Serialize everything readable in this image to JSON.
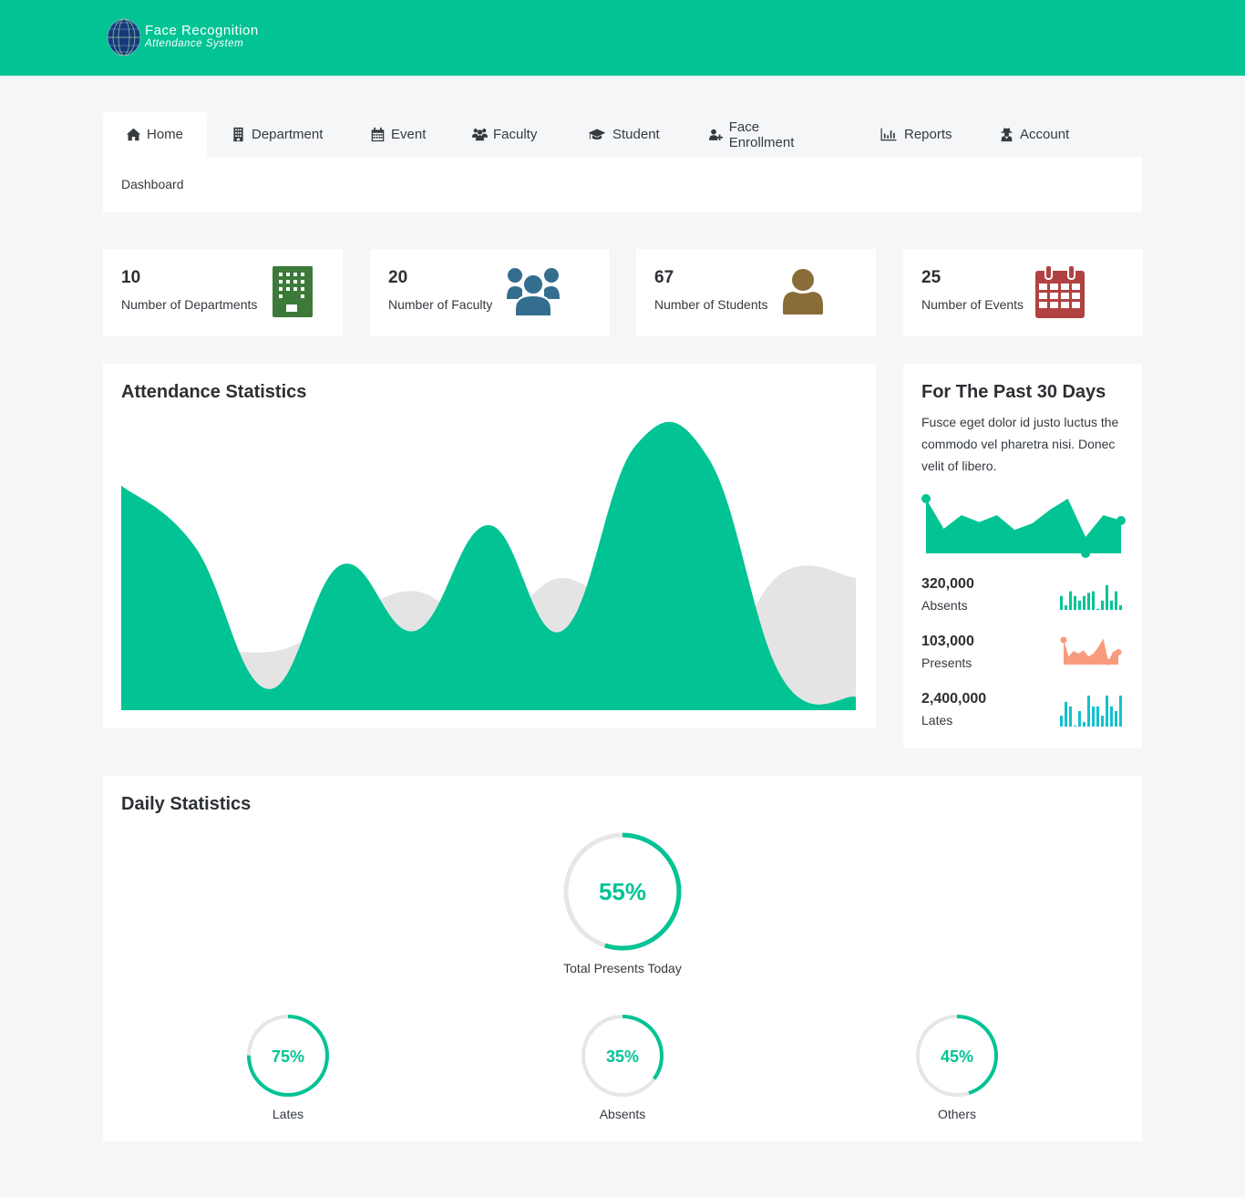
{
  "app": {
    "title_line1": "Face Recognition",
    "title_line2": "Attendance System",
    "brand_color": "#02c394"
  },
  "nav": {
    "tabs": [
      {
        "label": "Home",
        "icon": "home-icon",
        "active": true
      },
      {
        "label": "Department",
        "icon": "building-icon",
        "active": false
      },
      {
        "label": "Event",
        "icon": "calendar-icon",
        "active": false
      },
      {
        "label": "Faculty",
        "icon": "users-icon",
        "active": false
      },
      {
        "label": "Student",
        "icon": "graduation-cap-icon",
        "active": false
      },
      {
        "label": "Face Enrollment",
        "icon": "user-plus-icon",
        "active": false
      },
      {
        "label": "Reports",
        "icon": "bar-chart-icon",
        "active": false
      },
      {
        "label": "Account",
        "icon": "user-secret-icon",
        "active": false
      }
    ],
    "breadcrumb": "Dashboard"
  },
  "stats": [
    {
      "value": "10",
      "label": "Number of Departments",
      "icon": "building-icon",
      "color": "#3d7a3a"
    },
    {
      "value": "20",
      "label": "Number of Faculty",
      "icon": "users-icon",
      "color": "#336e8f"
    },
    {
      "value": "67",
      "label": "Number of Students",
      "icon": "user-icon",
      "color": "#8a6c38"
    },
    {
      "value": "25",
      "label": "Number of Events",
      "icon": "calendar-icon",
      "color": "#b04342"
    }
  ],
  "attendance": {
    "title": "Attendance Statistics"
  },
  "past30": {
    "title": "For The Past 30 Days",
    "description": "Fusce eget dolor id justo luctus the commodo vel pharetra nisi. Donec velit of libero.",
    "metrics": [
      {
        "value": "320,000",
        "label": "Absents",
        "color": "#02c394"
      },
      {
        "value": "103,000",
        "label": "Presents",
        "color": "#f89b7c"
      },
      {
        "value": "2,400,000",
        "label": "Lates",
        "color": "#12c1cc"
      }
    ]
  },
  "daily": {
    "title": "Daily Statistics",
    "main": {
      "percent": 55,
      "text": "55%",
      "label": "Total Presents Today"
    },
    "items": [
      {
        "percent": 75,
        "text": "75%",
        "label": "Lates"
      },
      {
        "percent": 35,
        "text": "35%",
        "label": "Absents"
      },
      {
        "percent": 45,
        "text": "45%",
        "label": "Others"
      }
    ]
  },
  "chart_data": [
    {
      "type": "area",
      "title": "Attendance Statistics",
      "xlabel": "",
      "ylabel": "",
      "grid": false,
      "legend": "none",
      "x": [
        0,
        1,
        2,
        3,
        4,
        5,
        6,
        7,
        8,
        9,
        10
      ],
      "ylim": [
        0,
        100
      ],
      "series": [
        {
          "name": "primary",
          "color": "#02c394",
          "values": [
            85,
            62,
            8,
            55,
            30,
            70,
            30,
            100,
            95,
            12,
            5
          ]
        },
        {
          "name": "secondary",
          "color": "#e4e4e4",
          "values": [
            60,
            30,
            22,
            34,
            45,
            30,
            50,
            30,
            15,
            52,
            50
          ]
        }
      ]
    },
    {
      "type": "area",
      "title": "Past 30 Days trend",
      "x": [
        0,
        1,
        2,
        3,
        4,
        5,
        6,
        7,
        8,
        9,
        10,
        11
      ],
      "ylim": [
        0,
        100
      ],
      "series": [
        {
          "name": "trend",
          "color": "#02c394",
          "values": [
            100,
            45,
            70,
            57,
            70,
            43,
            55,
            80,
            100,
            30,
            70,
            60
          ]
        }
      ]
    },
    {
      "type": "bar",
      "title": "Absents sparkline",
      "series": [
        {
          "name": "Absents",
          "color": "#02c394",
          "values": [
            45,
            15,
            60,
            45,
            30,
            45,
            55,
            60,
            3,
            30,
            80,
            30,
            60,
            15
          ]
        }
      ]
    },
    {
      "type": "area",
      "title": "Presents sparkline",
      "series": [
        {
          "name": "Presents",
          "color": "#f89b7c",
          "values": [
            90,
            30,
            50,
            40,
            52,
            30,
            40,
            65,
            95,
            10,
            50,
            45
          ]
        }
      ]
    },
    {
      "type": "bar",
      "title": "Lates sparkline",
      "series": [
        {
          "name": "Lates",
          "color": "#12c1cc",
          "values": [
            35,
            80,
            65,
            3,
            50,
            15,
            100,
            65,
            65,
            35,
            100,
            65,
            50,
            100
          ]
        }
      ]
    }
  ]
}
